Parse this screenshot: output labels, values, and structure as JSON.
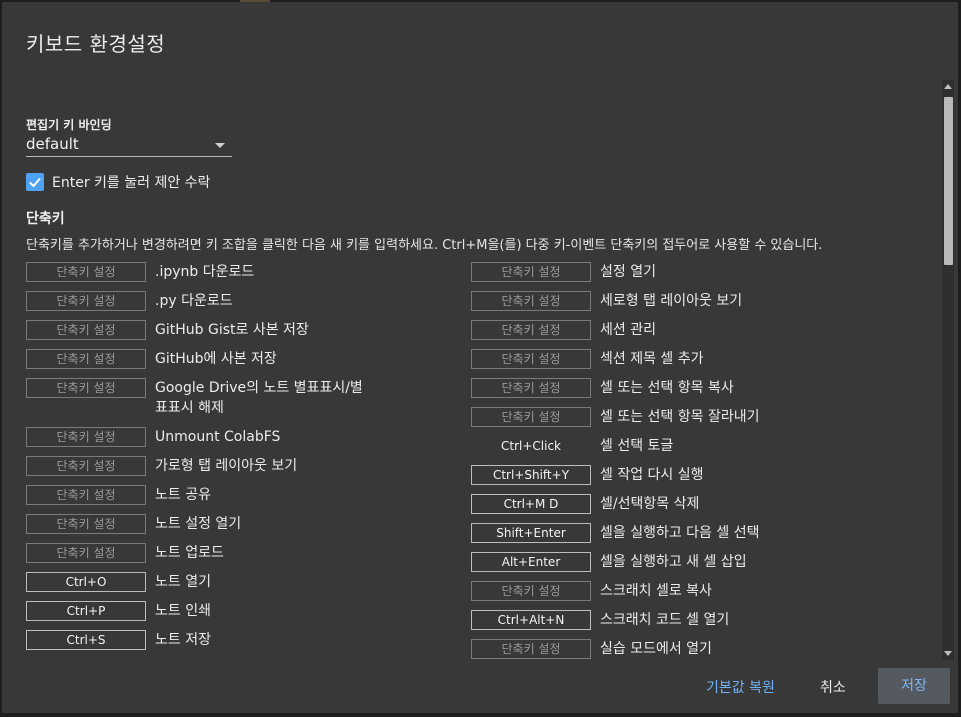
{
  "dialog": {
    "title": "키보드 환경설정"
  },
  "editor": {
    "label": "편집기 키 바인딩",
    "value": "default"
  },
  "checkbox": {
    "label": "Enter 키를 눌러 제안 수락",
    "checked": true
  },
  "shortcuts": {
    "title": "단축키",
    "description": "단축키를 추가하거나 변경하려면 키 조합을 클릭한 다음 새 키를 입력하세요. Ctrl+M을(를) 다중 키-이벤트 단축키의 접두어로 사용할 수 있습니다.",
    "placeholder": "단축키 설정",
    "left": [
      {
        "key": "",
        "command": ".ipynb 다운로드"
      },
      {
        "key": "",
        "command": ".py 다운로드"
      },
      {
        "key": "",
        "command": "GitHub Gist로 사본 저장"
      },
      {
        "key": "",
        "command": "GitHub에 사본 저장"
      },
      {
        "key": "",
        "command": "Google Drive의 노트 별표표시/별표표시 해제"
      },
      {
        "key": "",
        "command": "Unmount ColabFS"
      },
      {
        "key": "",
        "command": "가로형 탭 레이아웃 보기"
      },
      {
        "key": "",
        "command": "노트 공유"
      },
      {
        "key": "",
        "command": "노트 설정 열기"
      },
      {
        "key": "",
        "command": "노트 업로드"
      },
      {
        "key": "Ctrl+O",
        "command": "노트 열기"
      },
      {
        "key": "Ctrl+P",
        "command": "노트 인쇄"
      },
      {
        "key": "Ctrl+S",
        "command": "노트 저장"
      }
    ],
    "right": [
      {
        "key": "",
        "command": "설정 열기"
      },
      {
        "key": "",
        "command": "세로형 탭 레이아웃 보기"
      },
      {
        "key": "",
        "command": "세션 관리"
      },
      {
        "key": "",
        "command": "섹션 제목 셀 추가"
      },
      {
        "key": "",
        "command": "셀 또는 선택 항목 복사"
      },
      {
        "key": "",
        "command": "셀 또는 선택 항목 잘라내기"
      },
      {
        "key": "Ctrl+Click",
        "command": "셀 선택 토글",
        "noborder": true
      },
      {
        "key": "Ctrl+Shift+Y",
        "command": "셀 작업 다시 실행"
      },
      {
        "key": "Ctrl+M D",
        "command": "셀/선택항목 삭제"
      },
      {
        "key": "Shift+Enter",
        "command": "셀을 실행하고 다음 셀 선택"
      },
      {
        "key": "Alt+Enter",
        "command": "셀을 실행하고 새 셀 삽입"
      },
      {
        "key": "",
        "command": "스크래치 셀로 복사"
      },
      {
        "key": "Ctrl+Alt+N",
        "command": "스크래치 코드 셀 열기"
      },
      {
        "key": "",
        "command": "실습 모드에서 열기"
      }
    ]
  },
  "footer": {
    "reset": "기본값 복원",
    "cancel": "취소",
    "save": "저장"
  },
  "colors": {
    "accent": "#4ea1f3",
    "background": "#383838"
  }
}
